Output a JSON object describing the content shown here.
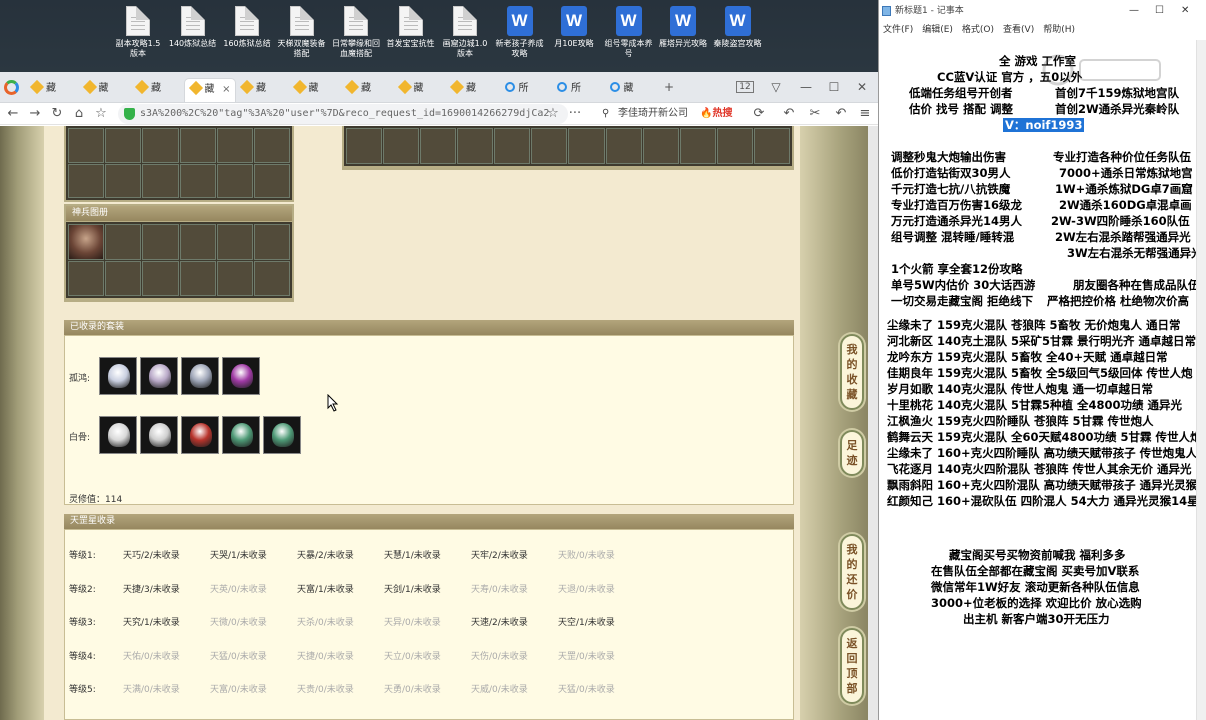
{
  "desktop": {
    "icons": [
      {
        "label": "副本攻略1.5版本",
        "type": "doc"
      },
      {
        "label": "140炼狱总结",
        "type": "doc"
      },
      {
        "label": "160炼狱总结",
        "type": "doc"
      },
      {
        "label": "天梯双魔装备搭配",
        "type": "doc"
      },
      {
        "label": "日常攀缘和回血魔搭配",
        "type": "doc"
      },
      {
        "label": "首发宝宝抗性",
        "type": "doc"
      },
      {
        "label": "画窟边城1.0版本",
        "type": "doc"
      },
      {
        "label": "新老孩子养成攻略",
        "type": "wps"
      },
      {
        "label": "月10E攻略",
        "type": "wps"
      },
      {
        "label": "组号零成本养号",
        "type": "wps"
      },
      {
        "label": "雁塔异光攻略",
        "type": "wps"
      },
      {
        "label": "秦陵盗宫攻略",
        "type": "wps"
      }
    ]
  },
  "browser": {
    "tabs": [
      {
        "label": "藏",
        "active": false,
        "favicon": "star"
      },
      {
        "label": "藏",
        "active": false,
        "favicon": "star"
      },
      {
        "label": "藏",
        "active": false,
        "favicon": "star"
      },
      {
        "label": "藏",
        "active": true,
        "favicon": "star"
      },
      {
        "label": "藏",
        "active": false,
        "favicon": "star"
      },
      {
        "label": "藏",
        "active": false,
        "favicon": "star"
      },
      {
        "label": "藏",
        "active": false,
        "favicon": "star"
      },
      {
        "label": "藏",
        "active": false,
        "favicon": "star"
      },
      {
        "label": "藏",
        "active": false,
        "favicon": "star"
      },
      {
        "label": "所",
        "active": false,
        "favicon": "globe"
      },
      {
        "label": "所",
        "active": false,
        "favicon": "globe"
      },
      {
        "label": "藏",
        "active": false,
        "favicon": "globe"
      }
    ],
    "new_tab": "+",
    "tab_count": "12",
    "window_controls": {
      "min": "—",
      "max": "☐",
      "close": "✕"
    },
    "url": "s3A%200%2C%20\"tag\"%3A%20\"user\"%7D&reco_request_id=1690014266279djCa2",
    "search_text": "李佳琦开新公司",
    "hot_label": "热搜",
    "nav": {
      "back": "←",
      "forward": "→",
      "reload": "↻",
      "home": "⌂",
      "star": "☆",
      "more": "···",
      "search": "⚲",
      "refresh": "⟳",
      "undo": "↶",
      "cut": "✂",
      "menu": "≡"
    }
  },
  "game_page": {
    "shenbing_title": "神兵图册",
    "collected_sets_title": "已收录的套装",
    "sets": [
      {
        "label": "孤鸿:",
        "icons": [
          "#c9cfe0",
          "#b9a9c8",
          "#9fa6b8",
          "#a03aa5"
        ]
      },
      {
        "label": "白骨:",
        "icons": [
          "#d8d8d8",
          "#cfcfcf",
          "#b8342c",
          "#4e9a76",
          "#4e9a76"
        ]
      }
    ],
    "lingxiu": "灵修值：114",
    "tiangang_title": "天罡星收录",
    "ranks": [
      {
        "label": "等级1:",
        "items": [
          {
            "t": "天巧/2/未收录",
            "on": true
          },
          {
            "t": "天哭/1/未收录",
            "on": true
          },
          {
            "t": "天暴/2/未收录",
            "on": true
          },
          {
            "t": "天慧/1/未收录",
            "on": true
          },
          {
            "t": "天牢/2/未收录",
            "on": true
          },
          {
            "t": "天败/0/未收录",
            "on": false
          }
        ]
      },
      {
        "label": "等级2:",
        "items": [
          {
            "t": "天捷/3/未收录",
            "on": true
          },
          {
            "t": "天英/0/未收录",
            "on": false
          },
          {
            "t": "天富/1/未收录",
            "on": true
          },
          {
            "t": "天剑/1/未收录",
            "on": true
          },
          {
            "t": "天寿/0/未收录",
            "on": false
          },
          {
            "t": "天退/0/未收录",
            "on": false
          }
        ]
      },
      {
        "label": "等级3:",
        "items": [
          {
            "t": "天究/1/未收录",
            "on": true
          },
          {
            "t": "天微/0/未收录",
            "on": false
          },
          {
            "t": "天杀/0/未收录",
            "on": false
          },
          {
            "t": "天异/0/未收录",
            "on": false
          },
          {
            "t": "天速/2/未收录",
            "on": true
          },
          {
            "t": "天空/1/未收录",
            "on": true
          }
        ]
      },
      {
        "label": "等级4:",
        "items": [
          {
            "t": "天佑/0/未收录",
            "on": false
          },
          {
            "t": "天猛/0/未收录",
            "on": false
          },
          {
            "t": "天捷/0/未收录",
            "on": false
          },
          {
            "t": "天立/0/未收录",
            "on": false
          },
          {
            "t": "天伤/0/未收录",
            "on": false
          },
          {
            "t": "天罡/0/未收录",
            "on": false
          }
        ]
      },
      {
        "label": "等级5:",
        "items": [
          {
            "t": "天满/0/未收录",
            "on": false
          },
          {
            "t": "天富/0/未收录",
            "on": false
          },
          {
            "t": "天贵/0/未收录",
            "on": false
          },
          {
            "t": "天勇/0/未收录",
            "on": false
          },
          {
            "t": "天威/0/未收录",
            "on": false
          },
          {
            "t": "天猛/0/未收录",
            "on": false
          }
        ]
      }
    ],
    "side_buttons": [
      {
        "label": "我的收藏"
      },
      {
        "label": "足迹"
      },
      {
        "label": "我的还价"
      },
      {
        "label": "返回顶部"
      }
    ]
  },
  "notepad": {
    "title": "新标题1 - 记事本",
    "menu": [
      "文件(F)",
      "编辑(E)",
      "格式(O)",
      "查看(V)",
      "帮助(H)"
    ],
    "controls": {
      "min": "—",
      "max": "☐",
      "close": "✕"
    },
    "lines": [
      {
        "t": "全 游戏 工作室",
        "hl": false
      },
      {
        "t": "CC蓝V认证  官方 ，五0以外",
        "hl": false
      },
      {
        "t": "低端任务组号开创者",
        "hl": false
      },
      {
        "t": "首创7千159炼狱地宫队",
        "hl": false
      },
      {
        "t": "估价 找号 搭配 调整",
        "hl": false
      },
      {
        "t": "首创2W通杀异光秦岭队",
        "hl": false
      },
      {
        "t": "V：noif1993",
        "hl": true
      },
      {
        "t": "调整秒鬼大炮输出伤害",
        "hl": false
      },
      {
        "t": "专业打造各种价位任务队伍",
        "hl": false
      },
      {
        "t": "低价打造钻街双30男人",
        "hl": false
      },
      {
        "t": "7000+通杀日常炼狱地宫",
        "hl": false
      },
      {
        "t": "千元打造七抗/八抗铁魔",
        "hl": false
      },
      {
        "t": "1W+通杀炼狱DG卓7画窟",
        "hl": false
      },
      {
        "t": "专业打造百万伤害16级龙",
        "hl": false
      },
      {
        "t": "2W通杀160DG卓混卓画",
        "hl": false
      },
      {
        "t": "万元打造通杀异光14男人",
        "hl": false
      },
      {
        "t": "2W-3W四阶睡杀160队伍",
        "hl": false
      },
      {
        "t": "组号调整 混转睡/睡转混",
        "hl": false
      },
      {
        "t": "2W左右混杀踏帮强通异光",
        "hl": false
      },
      {
        "t": "3W左右混杀无帮强通异光",
        "hl": false
      },
      {
        "t": "1个火箭 享全套12份攻略",
        "hl": false
      },
      {
        "t": "单号5W内估价 30大话西游",
        "hl": false
      },
      {
        "t": "朋友圈各种在售成品队伍",
        "hl": false
      },
      {
        "t": "一切交易走藏宝阁 拒绝线下",
        "hl": false
      },
      {
        "t": "严格把控价格 杜绝物次价高",
        "hl": false
      },
      {
        "t": "尘缘未了 159克火混队 苍狼阵 5畜牧 无价炮鬼人 通日常",
        "hl": false
      },
      {
        "t": "河北新区 140克土混队 5采矿5甘霖 景行明光齐 通卓越日常",
        "hl": false
      },
      {
        "t": "龙吟东方 159克火混队 5畜牧 全40+天赋 通卓越日常",
        "hl": false
      },
      {
        "t": "佳期良年 159克火混队 5畜牧 全5级回气5级回体 传世人炮",
        "hl": false
      },
      {
        "t": "岁月如歌 140克火混队 传世人炮鬼 通一切卓越日常",
        "hl": false
      },
      {
        "t": "十里桃花 140克火混队 5甘霖5种植 全4800功绩 通异光",
        "hl": false
      },
      {
        "t": "江枫渔火 159克火四阶睡队 苍狼阵 5甘霖 传世炮人",
        "hl": false
      },
      {
        "t": "鹤舞云天 159克火混队 全60天赋4800功绩 5甘霖 传世人炮",
        "hl": false
      },
      {
        "t": "尘缘未了 160+克火四阶睡队 高功绩天赋带孩子 传世炮鬼人",
        "hl": false
      },
      {
        "t": "飞花逐月 140克火四阶混队 苍狼阵 传世人其余无价 通异光",
        "hl": false
      },
      {
        "t": "飘雨斜阳 160+克火四阶混队 高功绩天赋带孩子 通异光灵猴",
        "hl": false
      },
      {
        "t": "红颜知己 160+混砍队伍 四阶混人 54大力 通异光灵猴14星",
        "hl": false
      },
      {
        "t": "藏宝阁买号买物资前喊我 福利多多",
        "hl": false
      },
      {
        "t": "在售队伍全部都在藏宝阁 买卖号加V联系",
        "hl": false
      },
      {
        "t": "微信常年1W好友 滚动更新各种队伍信息",
        "hl": false
      },
      {
        "t": "3000+位老板的选择 欢迎比价 放心选购",
        "hl": false
      },
      {
        "t": "出主机 新客户端30开无压力",
        "hl": false
      }
    ]
  }
}
